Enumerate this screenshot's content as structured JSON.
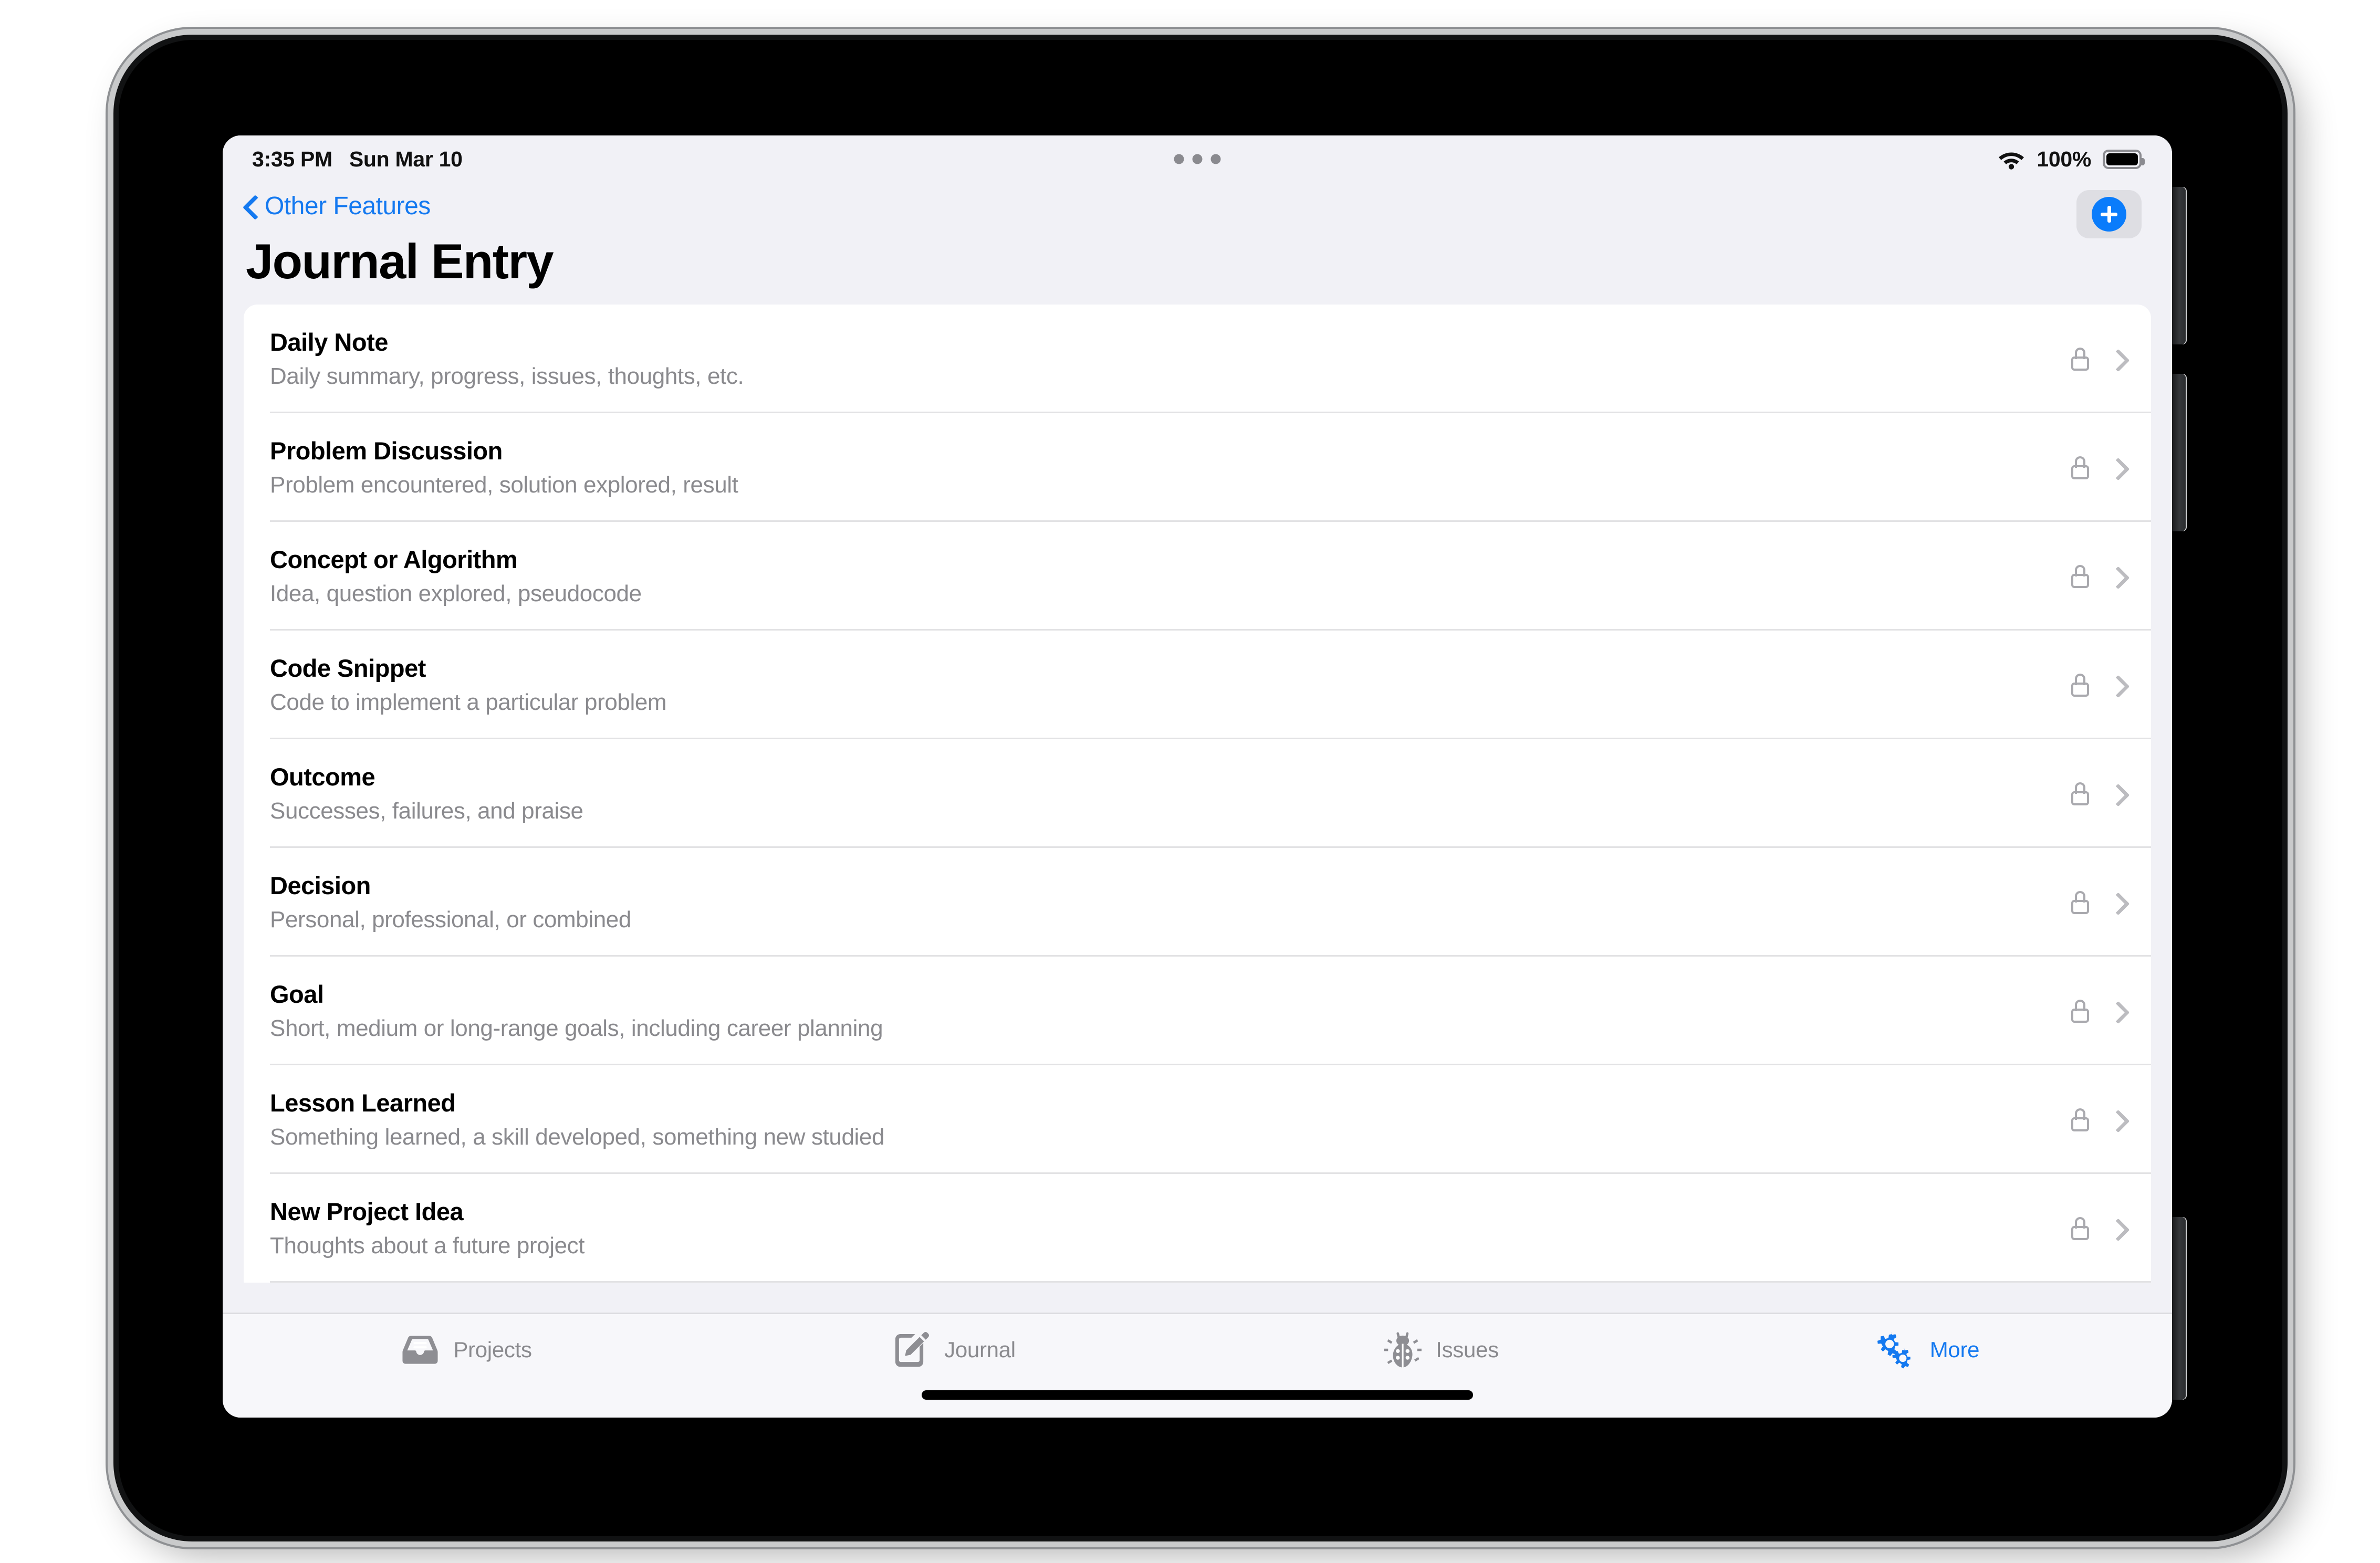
{
  "status_bar": {
    "time": "3:35 PM",
    "date": "Sun Mar 10",
    "wifi_icon": "wifi-icon",
    "battery_percent": "100%",
    "battery_icon": "battery-full-icon",
    "multitask_icon": "multitasking-dots-icon"
  },
  "nav_bar": {
    "back_icon": "chevron-left-icon",
    "back_label": "Other Features",
    "add_icon": "plus-circle-icon"
  },
  "page": {
    "title": "Journal Entry"
  },
  "list": {
    "rows": [
      {
        "title": "Daily Note",
        "subtitle": "Daily summary, progress, issues, thoughts, etc.",
        "lock_icon": "lock-icon",
        "disclosure_icon": "chevron-right-icon"
      },
      {
        "title": "Problem Discussion",
        "subtitle": "Problem encountered, solution explored, result",
        "lock_icon": "lock-icon",
        "disclosure_icon": "chevron-right-icon"
      },
      {
        "title": "Concept or Algorithm",
        "subtitle": "Idea, question explored, pseudocode",
        "lock_icon": "lock-icon",
        "disclosure_icon": "chevron-right-icon"
      },
      {
        "title": "Code Snippet",
        "subtitle": "Code to implement a particular problem",
        "lock_icon": "lock-icon",
        "disclosure_icon": "chevron-right-icon"
      },
      {
        "title": "Outcome",
        "subtitle": "Successes, failures, and praise",
        "lock_icon": "lock-icon",
        "disclosure_icon": "chevron-right-icon"
      },
      {
        "title": "Decision",
        "subtitle": "Personal, professional, or combined",
        "lock_icon": "lock-icon",
        "disclosure_icon": "chevron-right-icon"
      },
      {
        "title": "Goal",
        "subtitle": "Short, medium or long-range goals, including career planning",
        "lock_icon": "lock-icon",
        "disclosure_icon": "chevron-right-icon"
      },
      {
        "title": "Lesson Learned",
        "subtitle": "Something learned, a skill developed, something new studied",
        "lock_icon": "lock-icon",
        "disclosure_icon": "chevron-right-icon"
      },
      {
        "title": "New Project Idea",
        "subtitle": "Thoughts about a future project",
        "lock_icon": "lock-icon",
        "disclosure_icon": "chevron-right-icon"
      }
    ]
  },
  "tab_bar": {
    "tabs": [
      {
        "label": "Projects",
        "icon": "inbox-tray-icon",
        "active": false
      },
      {
        "label": "Journal",
        "icon": "square-pencil-icon",
        "active": false
      },
      {
        "label": "Issues",
        "icon": "ladybug-icon",
        "active": false
      },
      {
        "label": "More",
        "icon": "double-gear-icon",
        "active": true
      }
    ]
  },
  "colors": {
    "accent": "#1479f0",
    "add_button_blue": "#0a7cfb",
    "secondary_text": "#8a8a8e",
    "grouped_background": "#f1f1f6",
    "card_background": "#ffffff"
  },
  "home_indicator": "home-indicator"
}
